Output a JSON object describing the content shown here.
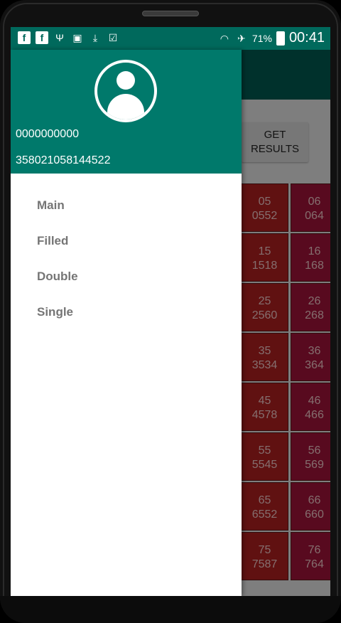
{
  "status_bar": {
    "battery": "71%",
    "time": "00:41"
  },
  "background": {
    "get_results_label": "GET\nRESULTS",
    "grid": [
      [
        "05\n0552",
        "06\n064"
      ],
      [
        "15\n1518",
        "16\n168"
      ],
      [
        "25\n2560",
        "26\n268"
      ],
      [
        "35\n3534",
        "36\n364"
      ],
      [
        "45\n4578",
        "46\n466"
      ],
      [
        "55\n5545",
        "56\n569"
      ],
      [
        "65\n6552",
        "66\n660"
      ],
      [
        "75\n7587",
        "76\n764"
      ]
    ]
  },
  "drawer": {
    "header": {
      "phone": "0000000000",
      "imei": "358021058144522"
    },
    "menu": [
      "Main",
      "Filled",
      "Double",
      "Single"
    ]
  },
  "colors": {
    "primary": "#00796b",
    "primary_dark": "#00695c",
    "cell_red": "#b01f1f",
    "cell_crimson": "#a0133a"
  }
}
